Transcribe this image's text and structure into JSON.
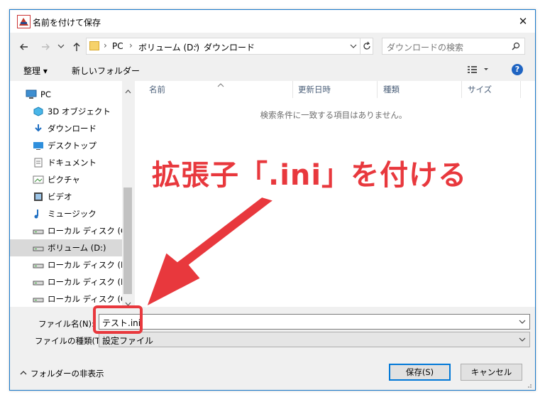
{
  "window": {
    "title": "名前を付けて保存",
    "close_glyph": "✕"
  },
  "address": {
    "crumbs": [
      "PC",
      "ボリューム (D:)",
      "ダウンロード"
    ],
    "search_placeholder": "ダウンロードの検索"
  },
  "toolbar": {
    "organize_label": "整理 ▾",
    "new_folder_label": "新しいフォルダー",
    "help_glyph": "?"
  },
  "sidebar": {
    "items": [
      {
        "label": "PC",
        "icon": "pc-icon"
      },
      {
        "label": "3D オブジェクト",
        "icon": "cube-icon"
      },
      {
        "label": "ダウンロード",
        "icon": "download-icon"
      },
      {
        "label": "デスクトップ",
        "icon": "desktop-icon"
      },
      {
        "label": "ドキュメント",
        "icon": "document-icon"
      },
      {
        "label": "ピクチャ",
        "icon": "picture-icon"
      },
      {
        "label": "ビデオ",
        "icon": "video-icon"
      },
      {
        "label": "ミュージック",
        "icon": "music-icon"
      },
      {
        "label": "ローカル ディスク (C:)",
        "icon": "drive-icon"
      },
      {
        "label": "ボリューム (D:)",
        "icon": "drive-icon",
        "selected": true
      },
      {
        "label": "ローカル ディスク (E:)",
        "icon": "drive-icon"
      },
      {
        "label": "ローカル ディスク (F:)",
        "icon": "drive-icon"
      },
      {
        "label": "ローカル ディスク (G:)",
        "icon": "drive-icon"
      }
    ]
  },
  "file_list": {
    "columns": [
      "名前",
      "更新日時",
      "種類",
      "サイズ"
    ],
    "empty_message": "検索条件に一致する項目はありません。"
  },
  "form": {
    "filename_label": "ファイル名(N):",
    "filename_value": "テスト.ini",
    "filetype_label": "ファイルの種類(T):",
    "filetype_value": "設定ファイル"
  },
  "footer": {
    "hide_folders_label": "フォルダーの非表示",
    "save_label": "保存(S)",
    "cancel_label": "キャンセル"
  },
  "annotation": {
    "text": "拡張子「.ini」を付ける",
    "color": "#e8383d"
  },
  "colors": {
    "accent": "#0078d7",
    "selected_bg": "#d9d9d9",
    "annotation_red": "#e8383d"
  }
}
